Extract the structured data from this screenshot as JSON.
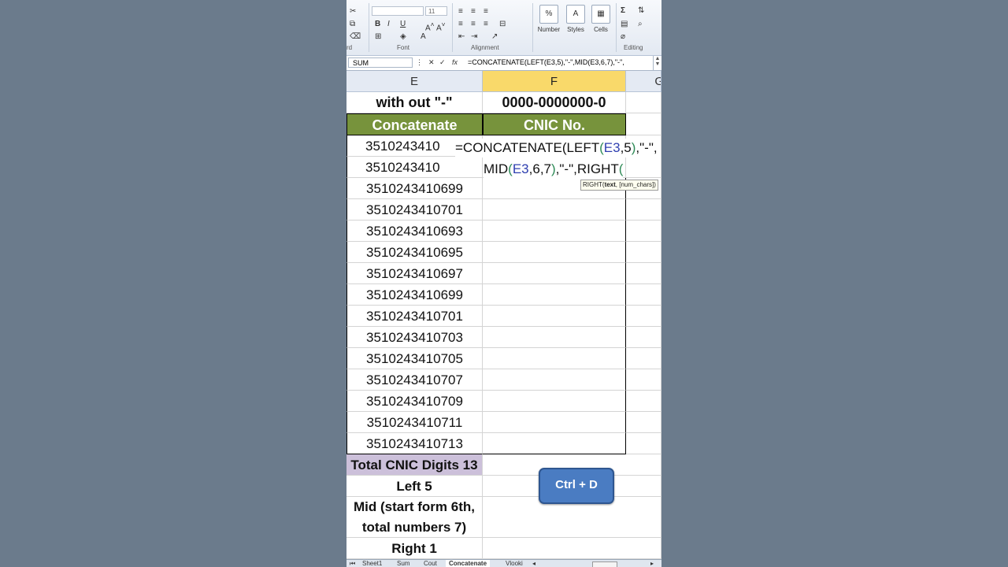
{
  "ribbon": {
    "font_name": "",
    "font_size": "11",
    "cut_label": "Cut",
    "clipboard_label": "rd",
    "font_group": "Font",
    "alignment_group": "Alignment",
    "number_label": "Number",
    "styles_label": "Styles",
    "cells_label": "Cells",
    "editing_group": "Editing",
    "percent_symbol": "%",
    "sigma_symbol": "Σ"
  },
  "formula_bar": {
    "name_box": "SUM",
    "fx": "fx",
    "formula": "=CONCATENATE(LEFT(E3,5),\"-\",MID(E3,6,7),\"-\","
  },
  "columns": {
    "E": "E",
    "F": "F",
    "G": "G"
  },
  "row1": {
    "e": "with out \"-\"",
    "f": "0000-0000000-0"
  },
  "row2": {
    "e": "Concatenate",
    "f": "CNIC No."
  },
  "edit": {
    "e3_partial": "3510243410",
    "e4_partial": "3510243410",
    "line1_pre": "=CONCATENATE",
    "line1_open": "(",
    "line1_fn": "LEFT",
    "line1_open2": "(",
    "line1_ref": "E3",
    "line1_num": ",5",
    "line1_close": ")",
    "line1_tail": ",\"-\",",
    "line2_fn": "MID",
    "line2_open": "(",
    "line2_ref": "E3",
    "line2_num": ",6,7",
    "line2_close": ")",
    "line2_tail": ",\"-\",RIGHT",
    "line2_open2": "(",
    "tooltip_fn": "RIGHT(",
    "tooltip_arg1": "text",
    "tooltip_rest": ", [num_chars])"
  },
  "cnic_values": [
    "3510243410699",
    "3510243410701",
    "3510243410693",
    "3510243410695",
    "3510243410697",
    "3510243410699",
    "3510243410701",
    "3510243410703",
    "3510243410705",
    "3510243410707",
    "3510243410709",
    "3510243410711",
    "3510243410713"
  ],
  "notes": {
    "total": "Total CNIC Digits 13",
    "left": "Left 5",
    "mid1": "Mid (start form 6th,",
    "mid2": "total numbers 7)",
    "right": "Right 1"
  },
  "shortcut_button": "Ctrl + D",
  "sheet_tabs": [
    "Sheet1",
    "Sum",
    "Cout",
    "Concatenate",
    "Vlooki"
  ],
  "active_tab": "Concatenate"
}
